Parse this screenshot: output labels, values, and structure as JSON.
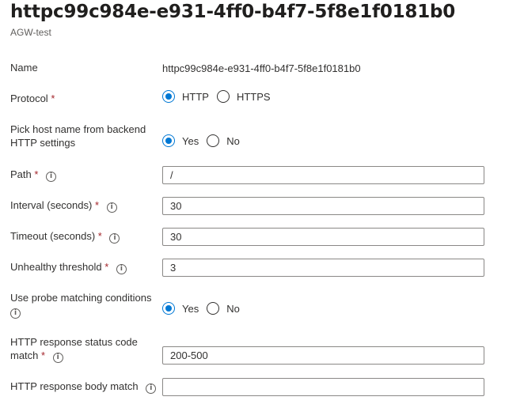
{
  "header": {
    "title": "httpc99c984e-e931-4ff0-b4f7-5f8e1f0181b0",
    "subtitle": "AGW-test"
  },
  "form": {
    "name": {
      "label": "Name",
      "value": "httpc99c984e-e931-4ff0-b4f7-5f8e1f0181b0"
    },
    "protocol": {
      "label": "Protocol",
      "required": "*",
      "options": [
        "HTTP",
        "HTTPS"
      ],
      "selected": "HTTP"
    },
    "pick_host": {
      "label_line1": "Pick host name from backend",
      "label_line2": "HTTP settings",
      "options": [
        "Yes",
        "No"
      ],
      "selected": "Yes"
    },
    "path": {
      "label": "Path",
      "required": "*",
      "info_icon": "info-icon",
      "value": "/"
    },
    "interval": {
      "label": "Interval (seconds)",
      "required": "*",
      "info_icon": "info-icon",
      "value": "30"
    },
    "timeout": {
      "label": "Timeout (seconds)",
      "required": "*",
      "info_icon": "info-icon",
      "value": "30"
    },
    "unhealthy": {
      "label": "Unhealthy threshold",
      "required": "*",
      "info_icon": "info-icon",
      "value": "3"
    },
    "probe_matching": {
      "label": "Use probe matching conditions",
      "info_icon": "info-icon",
      "options": [
        "Yes",
        "No"
      ],
      "selected": "Yes"
    },
    "status_code": {
      "label_line1": "HTTP response status code",
      "label_line2": "match",
      "required": "*",
      "info_icon": "info-icon",
      "value": "200-500"
    },
    "body_match": {
      "label": "HTTP response body match",
      "info_icon": "info-icon",
      "value": ""
    }
  },
  "colors": {
    "accent": "#0078d4",
    "required": "#a4262c",
    "border": "#8a8886"
  }
}
